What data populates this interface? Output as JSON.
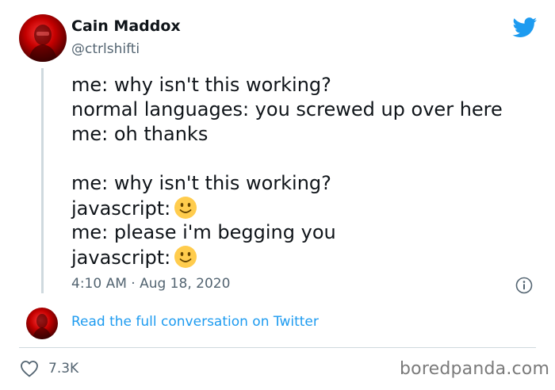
{
  "author": {
    "display_name": "Cain Maddox",
    "handle": "@ctrlshifti"
  },
  "brand_icon": "twitter-bird-icon",
  "colors": {
    "link": "#1d9bf0",
    "brand": "#1d9bf0",
    "secondary_text": "#536471",
    "divider": "#cfd9de"
  },
  "tweet": {
    "lines": [
      "me: why isn't this working?",
      "normal languages: you screwed up over here",
      "me: oh thanks",
      "",
      "me: why isn't this working?",
      "javascript:",
      "me: please i'm begging you",
      "javascript:"
    ],
    "emoji": "slightly-smiling-face-emoji",
    "timestamp": "4:10 AM · Aug 18, 2020"
  },
  "conversation_link": "Read the full conversation on Twitter",
  "likes": {
    "icon": "heart-icon",
    "count": "7.3K"
  },
  "watermark": "boredpanda.com"
}
